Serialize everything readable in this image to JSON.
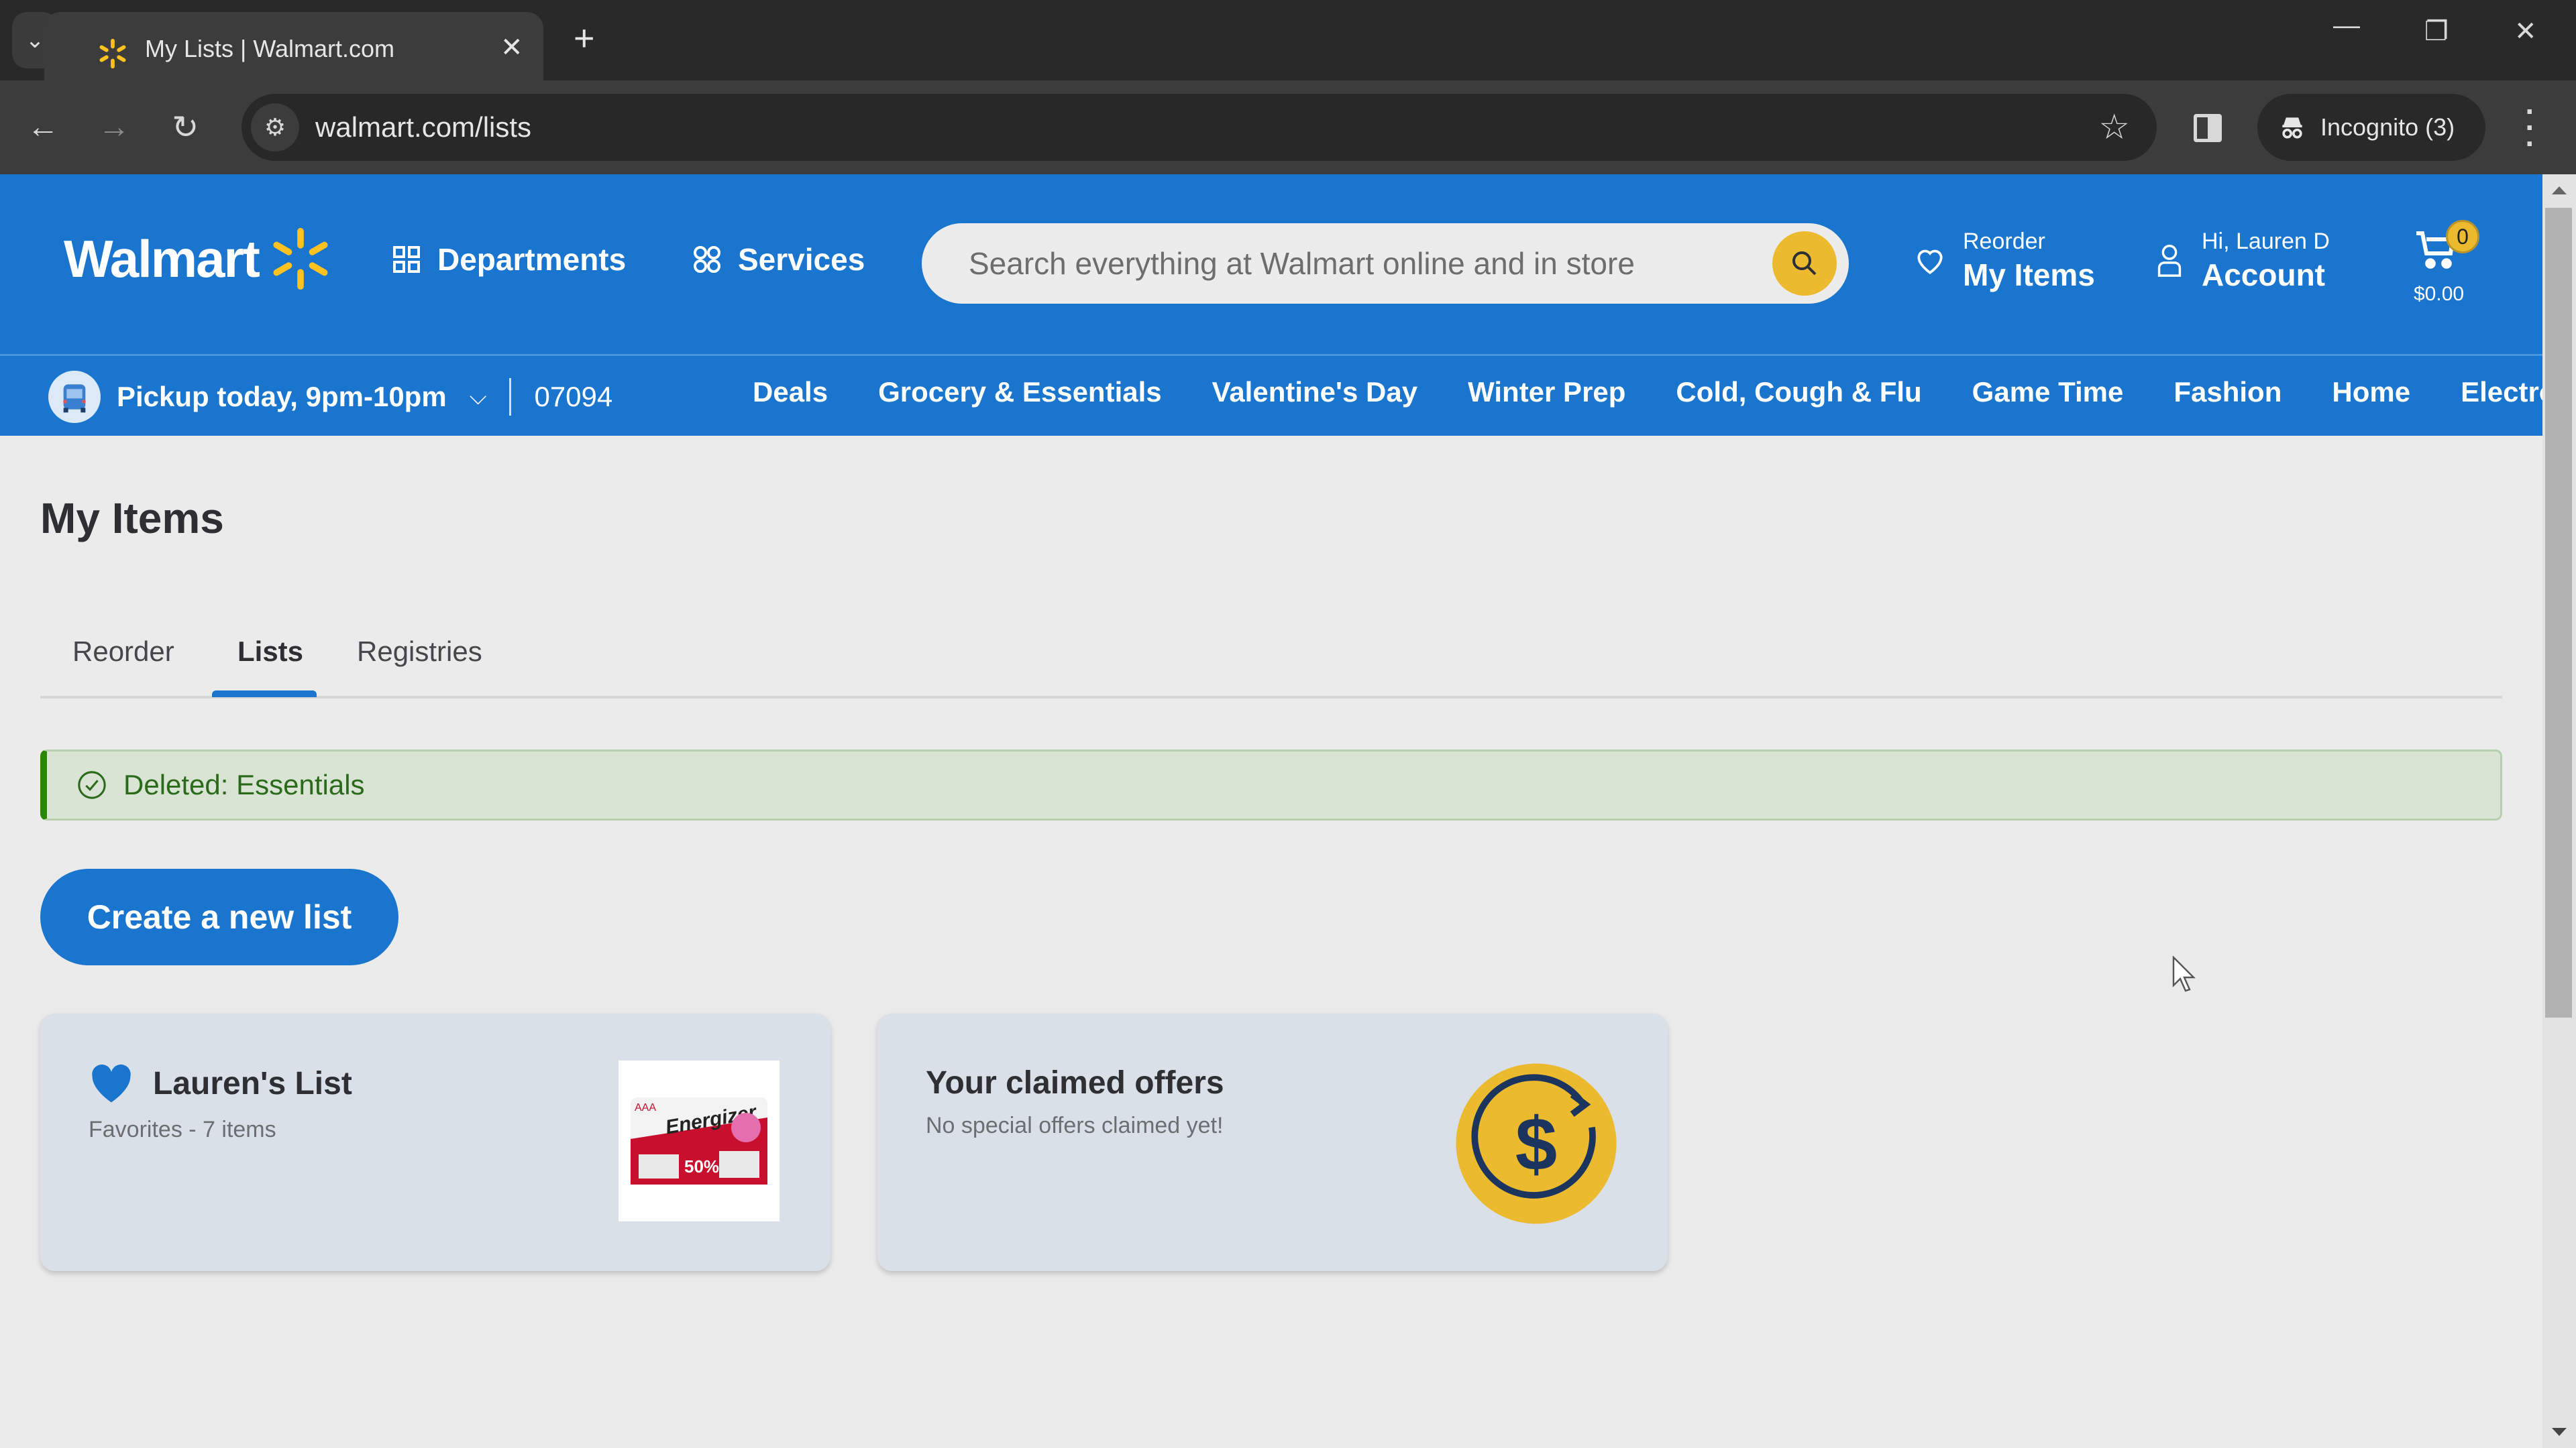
{
  "browser": {
    "tab_title": "My Lists | Walmart.com",
    "new_tab_label": "+",
    "url": "walmart.com/lists",
    "incognito_label": "Incognito (3)"
  },
  "header": {
    "logo_text": "Walmart",
    "departments_label": "Departments",
    "services_label": "Services",
    "search_placeholder": "Search everything at Walmart online and in store",
    "search_value": "",
    "reorder_small": "Reorder",
    "reorder_big": "My Items",
    "account_small": "Hi, Lauren D",
    "account_big": "Account",
    "cart_count": "0",
    "cart_total": "$0.00"
  },
  "subnav": {
    "pickup_label": "Pickup today, 9pm-10pm",
    "zip": "07094",
    "categories": [
      "Deals",
      "Grocery & Essentials",
      "Valentine's Day",
      "Winter Prep",
      "Cold, Cough & Flu",
      "Game Time",
      "Fashion",
      "Home",
      "Electronics"
    ]
  },
  "page": {
    "title": "My Items",
    "tabs": [
      {
        "label": "Reorder",
        "active": false
      },
      {
        "label": "Lists",
        "active": true
      },
      {
        "label": "Registries",
        "active": false
      }
    ],
    "alert_text": "Deleted: Essentials",
    "create_button": "Create a new list",
    "lists": [
      {
        "title": "Lauren's List",
        "subtitle": "Favorites - 7 items",
        "thumbnail": "Energizer AAA batteries"
      }
    ],
    "offers_card": {
      "title": "Your claimed offers",
      "subtitle": "No special offers claimed yet!"
    }
  },
  "colors": {
    "brand_blue": "#1a75cf",
    "spark_yellow": "#ffc220",
    "success_green": "#2a8703",
    "alert_bg": "#d9e4d4",
    "card_bg": "#d9e0e8"
  },
  "scroll": {
    "position_fraction": 0.0,
    "visible_fraction": 0.64
  }
}
